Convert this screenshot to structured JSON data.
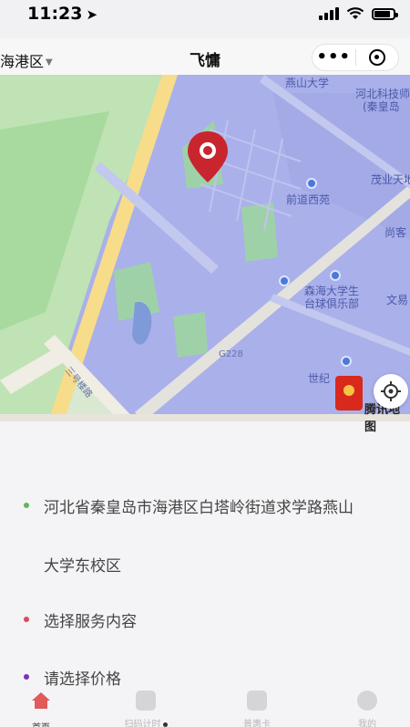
{
  "status_bar": {
    "time": "11:23",
    "location_arrow": "location-arrow-icon"
  },
  "nav": {
    "region": "海港区",
    "title": "飞慵",
    "menu_icon": "more-dots-icon",
    "close_icon": "capsule-close-icon"
  },
  "map": {
    "labels": {
      "yanshan_university": "燕山大学",
      "hebei_keji_1": "河北科技师",
      "hebei_keji_2": "(秦皇岛",
      "maoye": "茂业天地",
      "qiandao": "前道西苑",
      "shangke": "尚客",
      "senhai_1": "森海大学生",
      "senhai_2": "台球俱乐部",
      "wenyi": "文易",
      "road_g": "G228",
      "shiji": "世纪",
      "road_name": "三号楼路",
      "redpacket_text": "腾讯地图"
    },
    "colors": {
      "campus": "#a9b0ec",
      "green": "#9fd1a8",
      "road": "#f7dc8a",
      "water": "#7f9ad8"
    }
  },
  "info": {
    "address_line1": "河北省秦皇岛市海港区白塔岭街道求学路燕山",
    "address_line2": "大学东校区",
    "service": "选择服务内容",
    "price": "请选择价格",
    "dot_colors": {
      "address": "#5cb85c",
      "service": "#e0475b",
      "price": "#7b2fbf"
    }
  },
  "tabbar": {
    "items": [
      {
        "label": "首页",
        "icon": "home-icon"
      },
      {
        "label": "扫码计时",
        "icon": "scan-icon"
      },
      {
        "label": "普惠卡",
        "icon": "card-icon"
      },
      {
        "label": "我的",
        "icon": "profile-icon"
      }
    ]
  }
}
